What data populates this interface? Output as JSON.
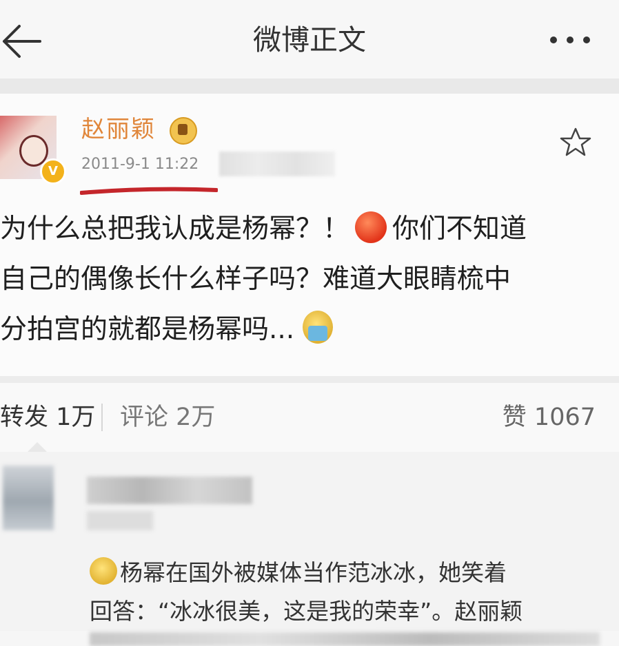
{
  "header": {
    "back_icon": "back-arrow-icon",
    "title": "微博正文",
    "more_icon": "more-dots-icon"
  },
  "post": {
    "author": "赵丽颖",
    "verified_badge_icon": "vip-verified-icon",
    "member_icon": "member-crown-icon",
    "timestamp": "2011-9-1 11:22",
    "favorite_icon": "star-icon",
    "text_lines": [
      "为什么总把我认成是杨幂？！",
      "你们不知道",
      "自己的偶像长什么样子吗？难道大眼睛梳中",
      "分拍宫的就都是杨幂吗..."
    ],
    "emojis": [
      "angry-emoji",
      "crying-emoji"
    ],
    "accent_color": "#e0863a"
  },
  "stats": {
    "repost_label": "转发",
    "repost_count": "1万",
    "comment_label": "评论",
    "comment_count": "2万",
    "like_label": "赞",
    "like_count": "1067"
  },
  "comment": {
    "emoji": "smile-emoji",
    "text_lines": [
      "杨幂在国外被媒体当作范冰冰，她笑着",
      "回答：“冰冰很美，这是我的荣幸”。赵丽颖"
    ]
  }
}
